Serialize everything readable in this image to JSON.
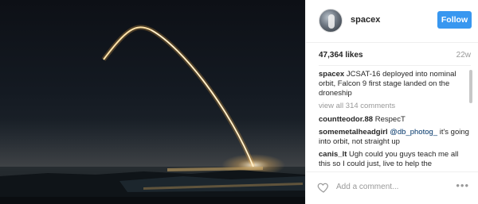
{
  "post": {
    "image": {
      "description_icon": "rocket-launch-photo"
    },
    "header": {
      "username": "spacex",
      "follow_label": "Follow"
    },
    "stats": {
      "likes": "47,364 likes",
      "age": "22w"
    },
    "caption": {
      "user": "spacex",
      "text": "JCSAT-16 deployed into nominal orbit, Falcon 9 first stage landed on the droneship"
    },
    "view_all": "view all 314 comments",
    "comments": [
      {
        "user": "countteodor.88",
        "pre": "RespecT",
        "mention": "",
        "post": ""
      },
      {
        "user": "somemetalheadgirl",
        "pre": "",
        "mention": "@db_photog_",
        "post": " it's going into orbit, not straight up"
      },
      {
        "user": "canis_lt",
        "pre": "Ugh could you guys teach me all this so I could just, live to help the",
        "mention": "",
        "post": ""
      }
    ],
    "footer": {
      "placeholder": "Add a comment...",
      "more": "•••"
    },
    "colors": {
      "follow": "#3897f0",
      "mention": "#003569"
    }
  }
}
